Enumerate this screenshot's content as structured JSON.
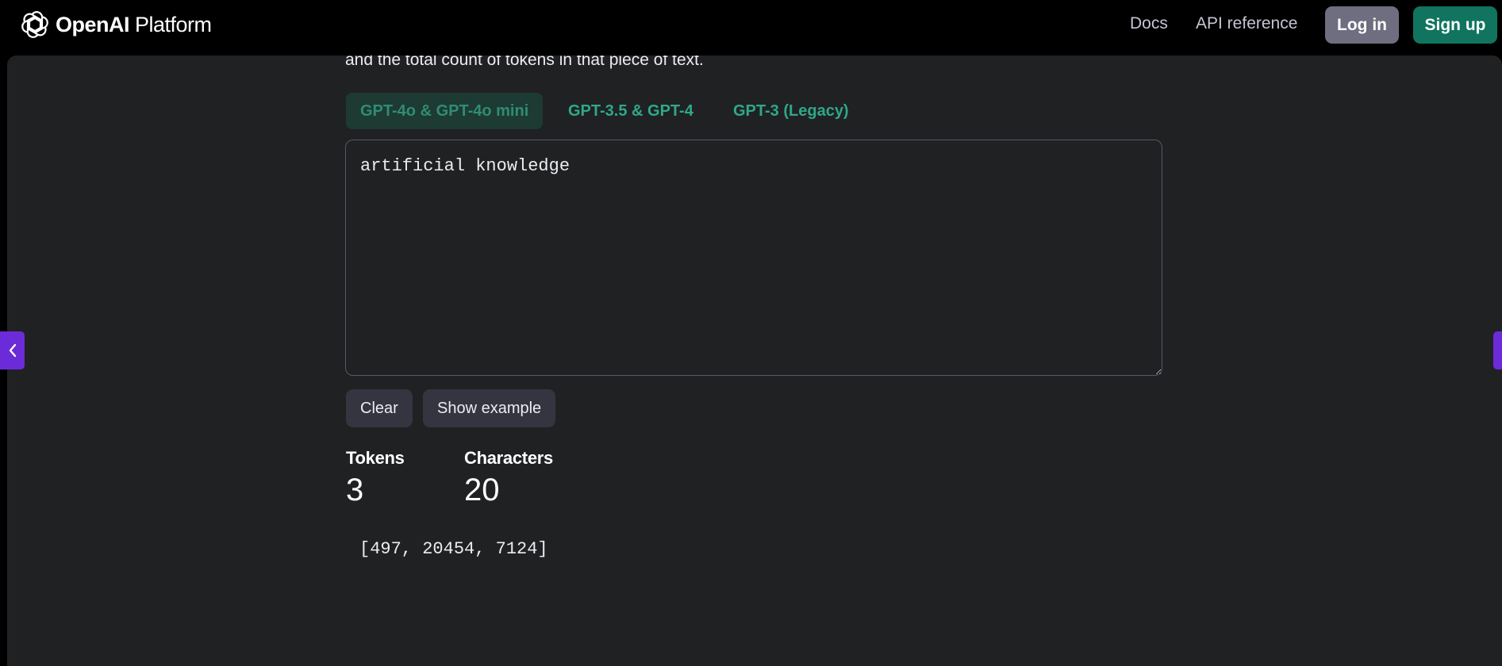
{
  "header": {
    "brand_bold": "OpenAI",
    "brand_rest": " Platform",
    "logo_icon": "openai-logo",
    "nav": {
      "docs": "Docs",
      "api_reference": "API reference"
    },
    "login_label": "Log in",
    "signup_label": "Sign up"
  },
  "intro_text": "and the total count of tokens in that piece of text.",
  "tabs": [
    {
      "label": "GPT-4o & GPT-4o mini",
      "active": true
    },
    {
      "label": "GPT-3.5 & GPT-4",
      "active": false
    },
    {
      "label": "GPT-3 (Legacy)",
      "active": false
    }
  ],
  "input": {
    "value": "artificial knowledge"
  },
  "actions": {
    "clear_label": "Clear",
    "example_label": "Show example"
  },
  "stats": {
    "tokens_label": "Tokens",
    "tokens_value": "3",
    "characters_label": "Characters",
    "characters_value": "20"
  },
  "token_ids_text": "[497, 20454, 7124]",
  "colors": {
    "page_bg": "#000000",
    "panel_bg": "#202123",
    "accent_green": "#10745f",
    "tab_text": "#2ea88a",
    "side_button": "#6c2bd9"
  }
}
